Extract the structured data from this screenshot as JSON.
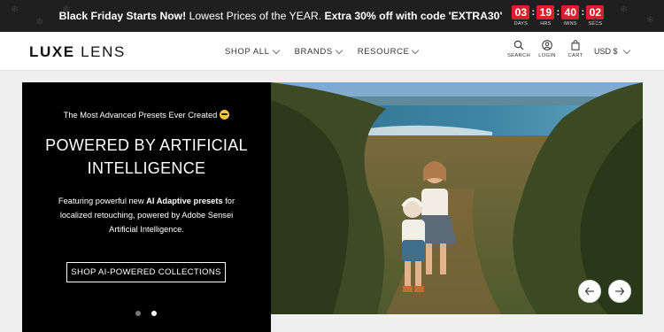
{
  "announcement": {
    "lead": "Black Friday Starts Now!",
    "middle": " Lowest Prices of the YEAR. ",
    "offer": "Extra 30% off with code 'EXTRA30'",
    "countdown": [
      {
        "value": "03",
        "label": "DAYS"
      },
      {
        "value": "19",
        "label": "HRS"
      },
      {
        "value": "40",
        "label": "MINS"
      },
      {
        "value": "02",
        "label": "SECS"
      }
    ],
    "separator": ":",
    "bg_color": "#1f1f1f",
    "timer_color": "#d6202e"
  },
  "header": {
    "logo_bold": "LUXE",
    "logo_light": "LENS",
    "nav": [
      "SHOP ALL",
      "BRANDS",
      "RESOURCE"
    ],
    "tools": {
      "search": {
        "label": "SEARCH",
        "icon": "search-icon"
      },
      "login": {
        "label": "LOGIN",
        "icon": "user-icon"
      },
      "cart": {
        "label": "CART",
        "icon": "bag-icon"
      }
    },
    "currency": "USD $"
  },
  "hero": {
    "eyebrow": "The Most Advanced Presets Ever Created",
    "headline": "POWERED BY ARTIFICIAL INTELLIGENCE",
    "body_pre": "Featuring powerful new ",
    "body_bold": "AI Adaptive presets",
    "body_post": " for localized retouching, powered by Adobe Sensei Artificial Intelligence.",
    "cta": "SHOP AI-POWERED COLLECTIONS",
    "slides_count": 2,
    "active_slide": 2,
    "image_icon": "two-children-on-coastal-path-photo"
  }
}
